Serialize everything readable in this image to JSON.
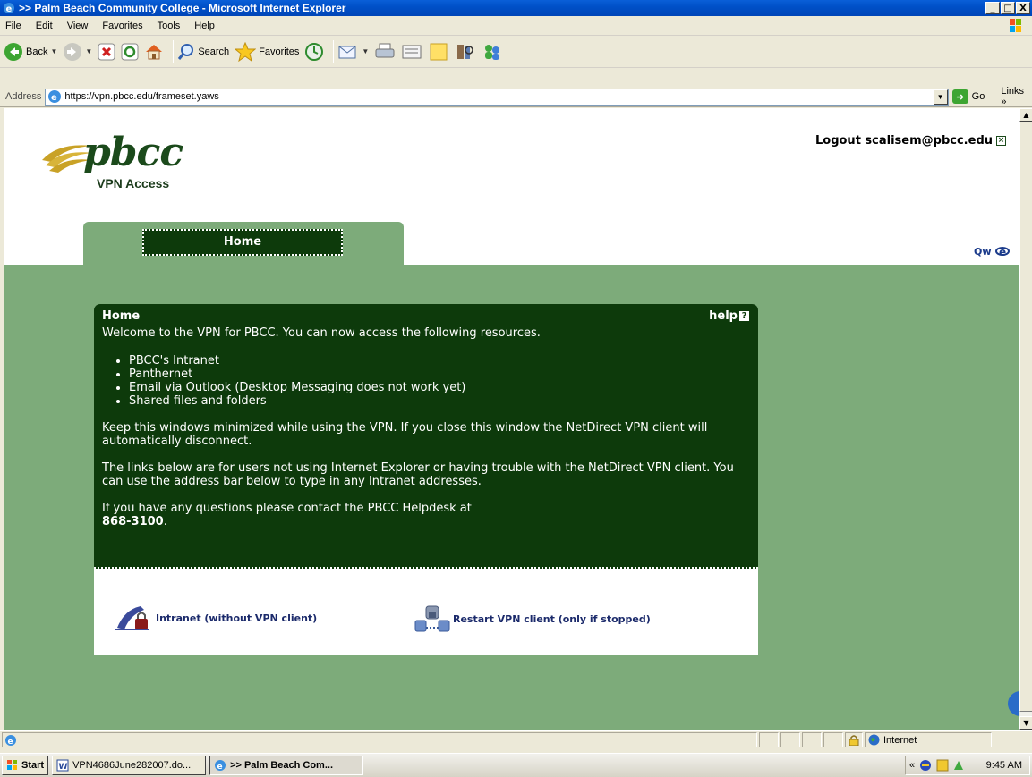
{
  "window": {
    "title": ">> Palm Beach Community College - Microsoft Internet Explorer",
    "controls": [
      "_",
      "□",
      "X"
    ]
  },
  "menu": [
    "File",
    "Edit",
    "View",
    "Favorites",
    "Tools",
    "Help"
  ],
  "toolbar": {
    "back": "Back",
    "search": "Search",
    "favorites": "Favorites"
  },
  "address": {
    "label": "Address",
    "url": "https://vpn.pbcc.edu/frameset.yaws",
    "go": "Go",
    "links": "Links"
  },
  "page": {
    "logo_text": "pbcc",
    "logo_sub": "VPN Access",
    "logout": "Logout scalisem@pbcc.edu",
    "tab": "Home",
    "panel": {
      "title": "Home",
      "help": "help",
      "intro": "Welcome to the VPN for PBCC. You can now access the following resources.",
      "resources": [
        "PBCC's Intranet",
        "Panthernet",
        "Email via Outlook (Desktop Messaging does not work yet)",
        "Shared files and folders"
      ],
      "para1": "Keep this windows minimized while using the VPN. If you close this window the NetDirect VPN client will automatically disconnect.",
      "para2": "The links below are for users not using Internet Explorer or having trouble with the NetDirect VPN client. You can use the address bar below to type in any Intranet addresses.",
      "para3": "If you have any questions please contact the PBCC Helpdesk at",
      "phone": "868-3100",
      "phone_suffix": "."
    },
    "links": {
      "intranet": "Intranet (without VPN client)",
      "restart": "Restart VPN client (only if stopped)"
    }
  },
  "status": {
    "zone": "Internet"
  },
  "taskbar": {
    "start": "Start",
    "tasks": [
      "VPN4686June282007.do...",
      ">> Palm Beach Com..."
    ],
    "clock": "9:45 AM"
  }
}
